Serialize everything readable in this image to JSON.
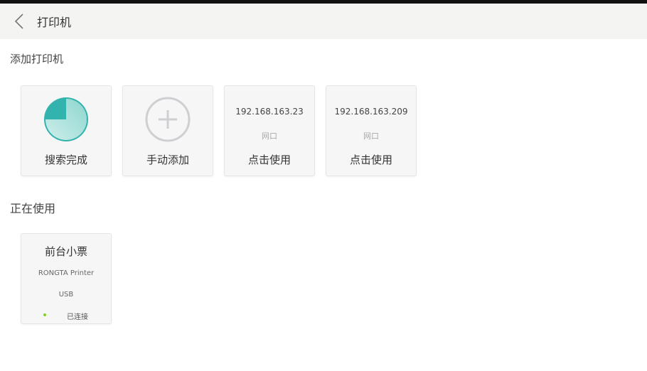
{
  "header": {
    "title": "打印机"
  },
  "add_section": {
    "title": "添加打印机",
    "search_card": {
      "label": "搜索完成"
    },
    "manual_card": {
      "label": "手动添加"
    },
    "network_printers": [
      {
        "ip": "192.168.163.23",
        "port": "网口",
        "action": "点击使用"
      },
      {
        "ip": "192.168.163.209",
        "port": "网口",
        "action": "点击使用"
      }
    ]
  },
  "using_section": {
    "title": "正在使用",
    "printer": {
      "name": "前台小票",
      "model": "RONGTA Printer",
      "connection": "USB",
      "status": "已连接"
    }
  },
  "colors": {
    "accent": "#33b3ad",
    "status_connected": "#7ed321",
    "header_bg": "#f4f4f2"
  },
  "icons": {
    "back": "chevron-left-icon",
    "search": "search-progress-icon",
    "add": "plus-circle-icon"
  }
}
